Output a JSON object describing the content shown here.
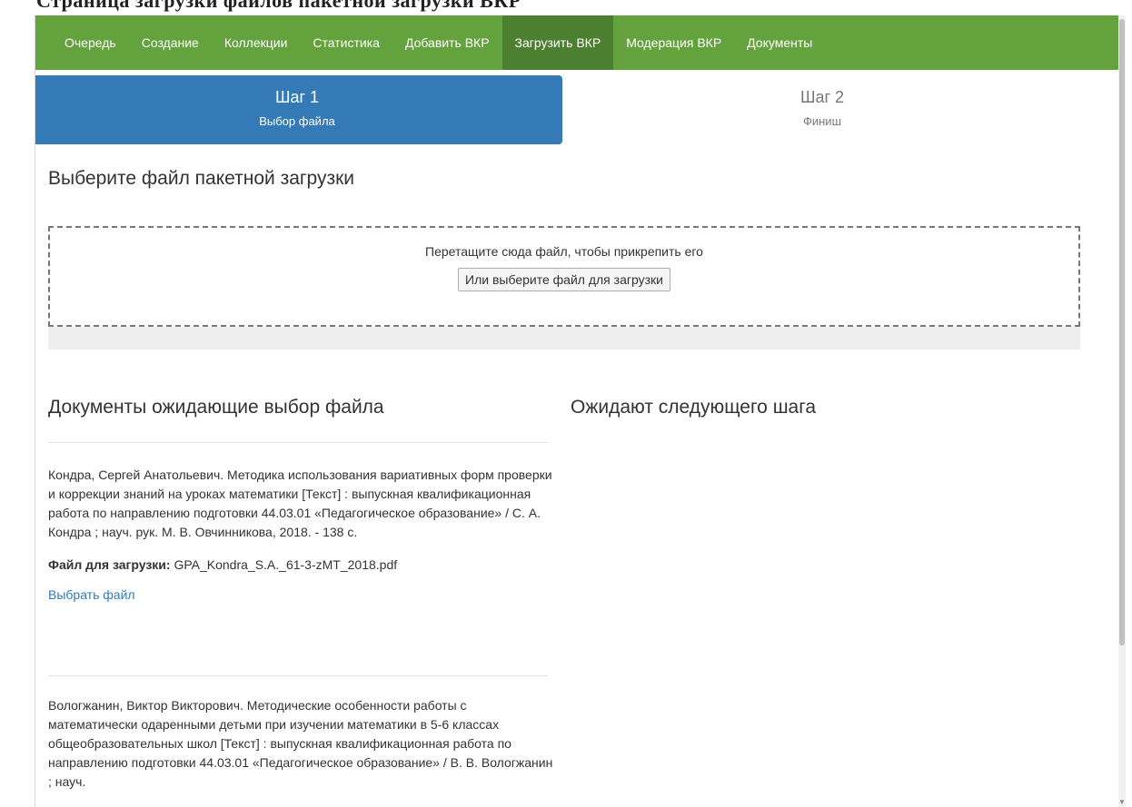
{
  "caption": "Страница загрузки файлов пакетной загрузки ВКР",
  "nav": {
    "items": [
      {
        "label": "Очередь",
        "active": false
      },
      {
        "label": "Создание",
        "active": false
      },
      {
        "label": "Коллекции",
        "active": false
      },
      {
        "label": "Статистика",
        "active": false
      },
      {
        "label": "Добавить ВКР",
        "active": false
      },
      {
        "label": "Загрузить ВКР",
        "active": true
      },
      {
        "label": "Модерация ВКР",
        "active": false
      },
      {
        "label": "Документы",
        "active": false
      }
    ]
  },
  "steps": [
    {
      "title": "Шаг 1",
      "subtitle": "Выбор файла",
      "active": true
    },
    {
      "title": "Шаг 2",
      "subtitle": "Финиш",
      "active": false
    }
  ],
  "upload": {
    "title": "Выберите файл пакетной загрузки",
    "drop_text": "Перетащите сюда файл, чтобы прикрепить его",
    "button_label": "Или выберите файл для загрузки"
  },
  "pending": {
    "title": "Документы ожидающие выбор файла",
    "file_label": "Файл для загрузки:",
    "pick_link": "Выбрать файл",
    "documents": [
      {
        "description": "Кондра, Сергей Анатольевич. Методика использования вариативных форм проверки и коррекции знаний на уроках математики [Текст] : выпускная квалификационная работа по направлению подготовки 44.03.01 «Педагогическое образование» / С. А. Кондра ; науч. рук. М. В. Овчинникова, 2018. - 138 с.",
        "file_name": "GPA_Kondra_S.A._61-3-zMT_2018.pdf"
      },
      {
        "description": "Вологжанин, Виктор Викторович. Методические особенности работы с математически одаренными детьми при изучении математики в 5-6 классах общеобразовательных школ [Текст] : выпускная квалификационная работа по направлению подготовки 44.03.01 «Педагогическое образование» / В. В. Вологжанин ; науч."
      }
    ]
  },
  "next_step": {
    "title": "Ожидают следующего шага"
  },
  "colors": {
    "navbar": "#64a23e",
    "navbar_active": "#4d7f31",
    "step_active": "#337ab7",
    "link": "#337ab7"
  }
}
